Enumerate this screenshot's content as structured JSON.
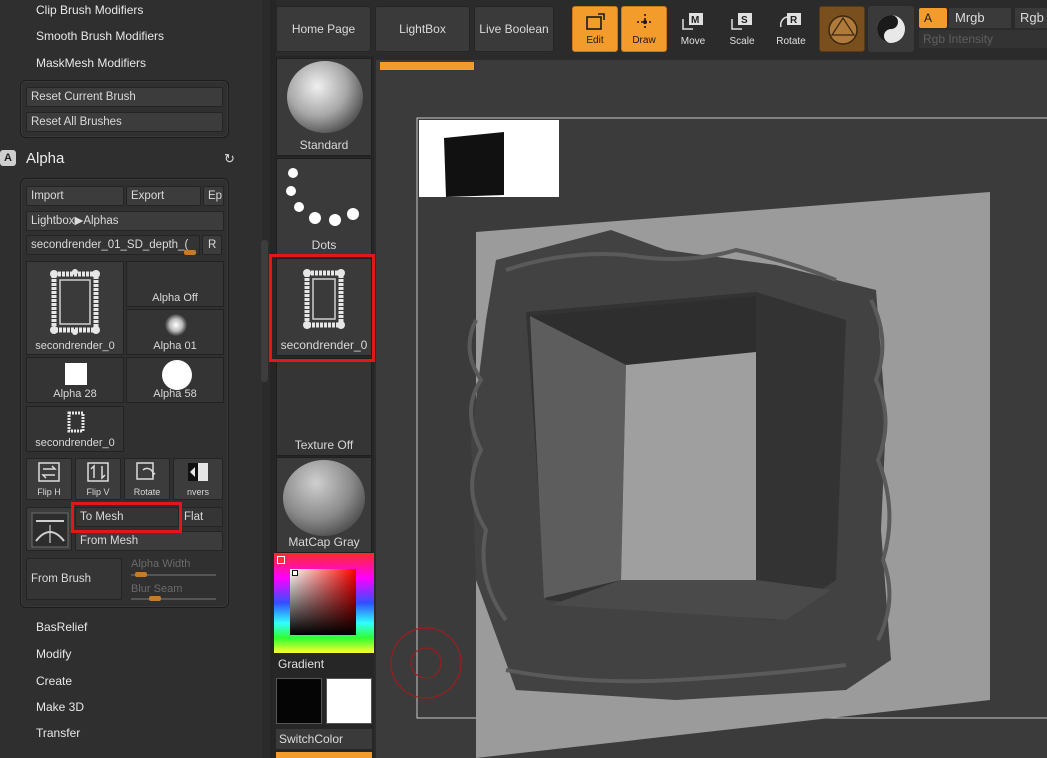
{
  "left_panel": {
    "top_menu": [
      "Clip Brush Modifiers",
      "Smooth Brush Modifiers",
      "MaskMesh Modifiers"
    ],
    "reset_current_brush": "Reset Current Brush",
    "reset_all_brushes": "Reset All Brushes",
    "alpha_badge": "A",
    "alpha_title": "Alpha",
    "refresh_glyph": "↻",
    "import": "Import",
    "export": "Export",
    "ep": "Ep",
    "lightbox_alphas": "Lightbox▶Alphas",
    "current_alpha_name": "secondrender_01_SD_depth_(",
    "r_button": "R",
    "thumbs": {
      "current_large_label": "secondrender_0",
      "alpha_off": "Alpha Off",
      "alpha01": "Alpha 01",
      "alpha28": "Alpha 28",
      "alpha58": "Alpha 58",
      "small_label": "secondrender_0"
    },
    "tools": {
      "flip_h": "Flip H",
      "flip_v": "Flip V",
      "rotate": "Rotate",
      "invers": "nvers"
    },
    "to_mesh": "To Mesh",
    "flat": "Flat",
    "from_mesh": "From Mesh",
    "from_brush": "From Brush",
    "alpha_width": "Alpha Width",
    "blur_seam": "Blur Seam",
    "sub_menus": [
      "BasRelief",
      "Modify",
      "Create",
      "Make 3D",
      "Transfer"
    ]
  },
  "shelf": {
    "standard": "Standard",
    "dots": "Dots",
    "alpha_tile": "secondrender_0",
    "texture_off": "Texture Off",
    "matcap": "MatCap Gray",
    "gradient": "Gradient",
    "switch_color": "SwitchColor"
  },
  "toolbar": {
    "home_page": "Home Page",
    "lightbox": "LightBox",
    "live_boolean": "Live Boolean",
    "edit": "Edit",
    "draw": "Draw",
    "move": "Move",
    "scale": "Scale",
    "rotate": "Rotate",
    "a_toggle": "A",
    "mrgb": "Mrgb",
    "rgb": "Rgb",
    "rgb_intensity": "Rgb Intensity"
  },
  "colors": {
    "accent": "#f39c2c",
    "highlight": "#e0181c",
    "canvas_bg": "#3b3b3b"
  }
}
